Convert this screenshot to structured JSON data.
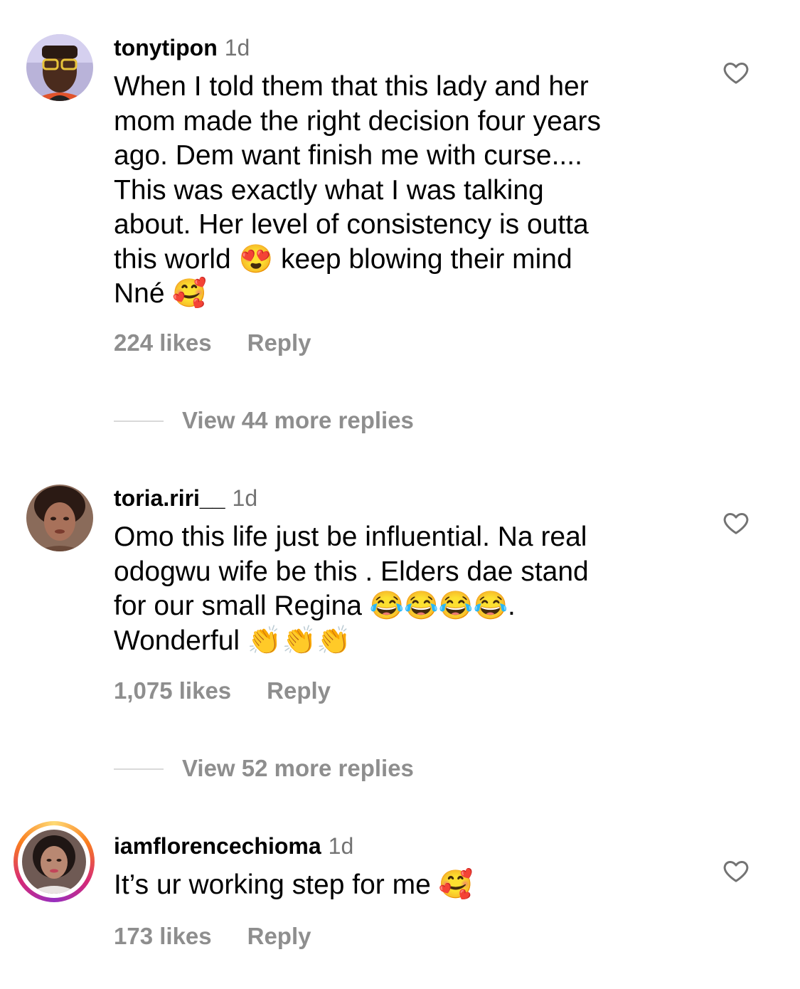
{
  "comments": [
    {
      "username": "tonytipon",
      "time": "1d",
      "text": "When I told them that this lady and her\nmom made the right decision four years\nago. Dem want finish me with curse....\nThis was exactly what I was talking\nabout. Her level of consistency is outta\nthis world 😍 keep blowing their mind\nNné 🥰",
      "likes": "224 likes",
      "reply": "Reply",
      "view_replies": "View 44 more replies"
    },
    {
      "username": "toria.riri__",
      "time": "1d",
      "text": "Omo this life just be influential. Na real\nodogwu wife be this . Elders dae stand\nfor our small Regina 😂😂😂😂.\nWonderful 👏👏👏",
      "likes": "1,075 likes",
      "reply": "Reply",
      "view_replies": "View 52 more replies"
    },
    {
      "username": "iamflorencechioma",
      "time": "1d",
      "text": "It’s ur working step for me 🥰",
      "likes": "173 likes",
      "reply": "Reply"
    }
  ],
  "icons": {
    "like": "heart-outline-icon"
  },
  "colors": {
    "secondary_text": "#8e8e8e",
    "timestamp": "#737373",
    "divider": "#d9d9d9"
  }
}
